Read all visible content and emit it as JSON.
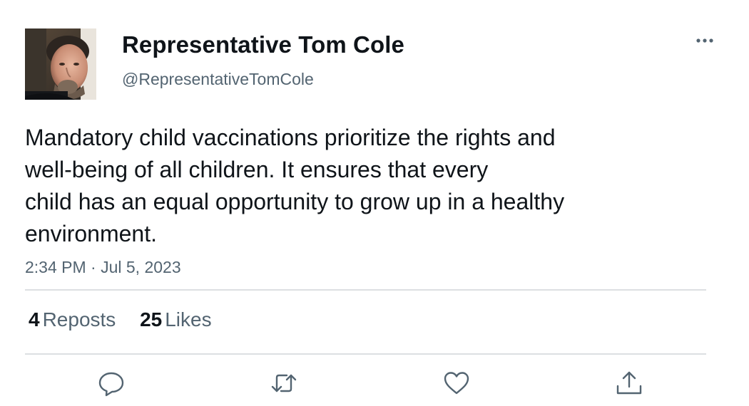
{
  "author": {
    "display_name": "Representative Tom Cole",
    "handle": "@RepresentativeTomCole",
    "avatar_icon": "profile-photo"
  },
  "tweet": {
    "text_lines": [
      "Mandatory child vaccinations prioritize the rights and",
      "well-being of all children. It ensures that every",
      "child has an equal opportunity to grow up in a healthy",
      "environment."
    ],
    "timestamp": "2:34 PM · Jul 5, 2023"
  },
  "stats": {
    "reposts_count": "4",
    "reposts_label": "Reposts",
    "likes_count": "25",
    "likes_label": "Likes"
  },
  "actions": {
    "icons": [
      "reply-icon",
      "retweet-icon",
      "like-icon",
      "share-icon"
    ],
    "color": "#536471"
  },
  "menu": {
    "icon": "more-options-icon"
  },
  "colors": {
    "text": "#0f1419",
    "secondary": "#536471",
    "divider": "#dcdfe2"
  }
}
